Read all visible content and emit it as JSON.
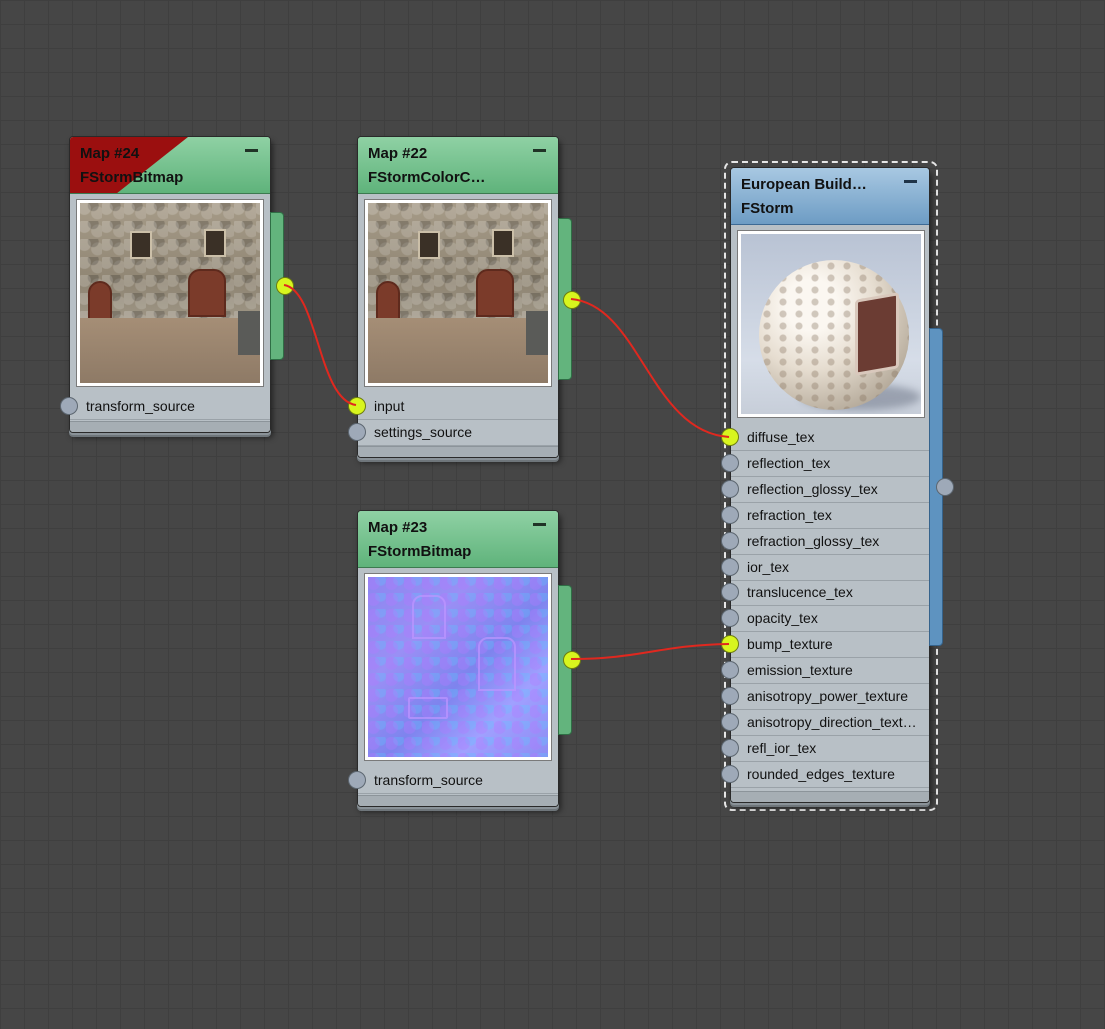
{
  "nodes": {
    "map24": {
      "title": "Map #24",
      "type": "FStormBitmap",
      "slots": [
        "transform_source"
      ]
    },
    "map22": {
      "title": "Map #22",
      "type": "FStormColorC…",
      "slots": [
        "input",
        "settings_source"
      ]
    },
    "map23": {
      "title": "Map #23",
      "type": "FStormBitmap",
      "slots": [
        "transform_source"
      ]
    },
    "material": {
      "title": "European  Build…",
      "type": "FStorm",
      "slots": [
        "diffuse_tex",
        "reflection_tex",
        "reflection_glossy_tex",
        "refraction_tex",
        "refraction_glossy_tex",
        "ior_tex",
        "translucence_tex",
        "opacity_tex",
        "bump_texture",
        "emission_texture",
        "anisotropy_power_texture",
        "anisotropy_direction_text…",
        "refl_ior_tex",
        "rounded_edges_texture"
      ]
    }
  },
  "colors": {
    "canvas": "#464646",
    "header_green": "#6fbf89",
    "header_blue": "#7aa7cd",
    "error_flag": "#9b0f0f",
    "wire": "#e0281f",
    "active_port": "#d8f51e",
    "inactive_port": "#9ea9b8"
  }
}
